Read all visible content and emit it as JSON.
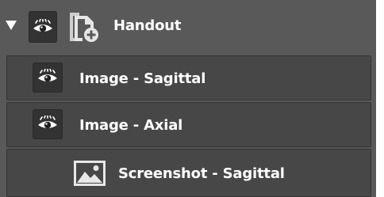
{
  "tree": {
    "group": {
      "label": "Handout",
      "expanded": true,
      "caret_icon": "triangle-down",
      "visibility_icon": "eye",
      "type_icon": "handout-add"
    },
    "items": [
      {
        "label": "Image - Sagittal",
        "visibility_icon": "eye"
      },
      {
        "label": "Image - Axial",
        "visibility_icon": "eye"
      },
      {
        "label": "Screenshot - Sagittal",
        "type_icon": "image"
      }
    ]
  },
  "colors": {
    "panel_bg": "#595959",
    "row_bg": "#474747",
    "button_bg": "#333333",
    "text": "#ffffff"
  }
}
